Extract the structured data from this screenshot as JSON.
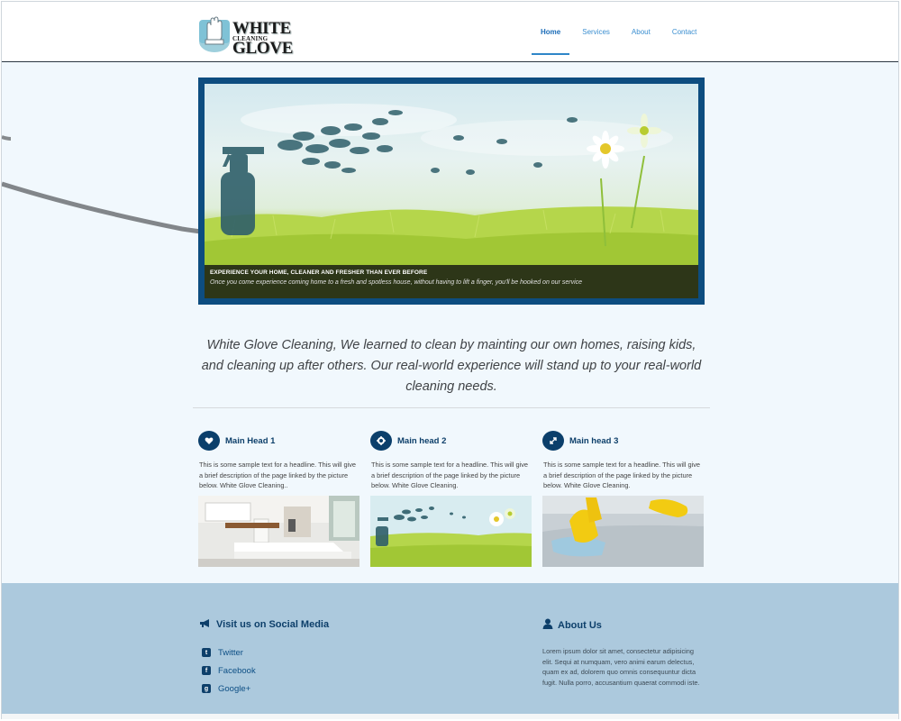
{
  "header": {
    "logo": {
      "line1": "WHITE GLOVE",
      "line2": "CLEANING"
    },
    "nav": [
      {
        "label": "Home",
        "active": true
      },
      {
        "label": "Services",
        "active": false
      },
      {
        "label": "About",
        "active": false
      },
      {
        "label": "Contact",
        "active": false
      }
    ]
  },
  "hero": {
    "caption_title": "EXPERIENCE YOUR HOME, CLEANER AND FRESHER THAN EVER BEFORE",
    "caption_text": "Once you come experience coming home to a fresh and spotless house, without having to lift a finger, you'll be hooked on our service"
  },
  "intro": "White Glove Cleaning, We learned to clean by mainting our own homes, raising kids, and cleaning up after others. Our real-world experience will stand up to your real-world cleaning needs.",
  "features": [
    {
      "title": "Main Head 1",
      "icon": "heart-icon",
      "text": "This is some sample text for a headline. This will give a brief description of the page linked by the picture below. White Glove Cleaning.."
    },
    {
      "title": "Main head 2",
      "icon": "gear-icon",
      "text": "This is some sample text for a headline. This will give a brief description of the page linked by the picture below. White Glove Cleaning."
    },
    {
      "title": "Main head 3",
      "icon": "expand-icon",
      "text": "This is some sample text for a headline. This will give a brief description of the page linked by the picture below. White Glove Cleaning."
    }
  ],
  "footer": {
    "social_heading": "Visit us on Social Media",
    "social_links": [
      {
        "label": "Twitter",
        "icon": "twitter-icon"
      },
      {
        "label": "Facebook",
        "icon": "facebook-icon"
      },
      {
        "label": "Google+",
        "icon": "google-plus-icon"
      }
    ],
    "about_heading": "About Us",
    "about_text": "Lorem ipsum dolor sit amet, consectetur adipisicing elit. Sequi at numquam, vero animi earum delectus, quam ex ad, dolorem quo omnis consequuntur dicta fugit. Nulla porro, accusantium quaerat commodi iste."
  },
  "colors": {
    "brand_dark": "#0d3f6a",
    "nav_link": "#3a8ed0",
    "page_bg": "#f1f8fd",
    "footer_bg": "#acc9dd"
  }
}
